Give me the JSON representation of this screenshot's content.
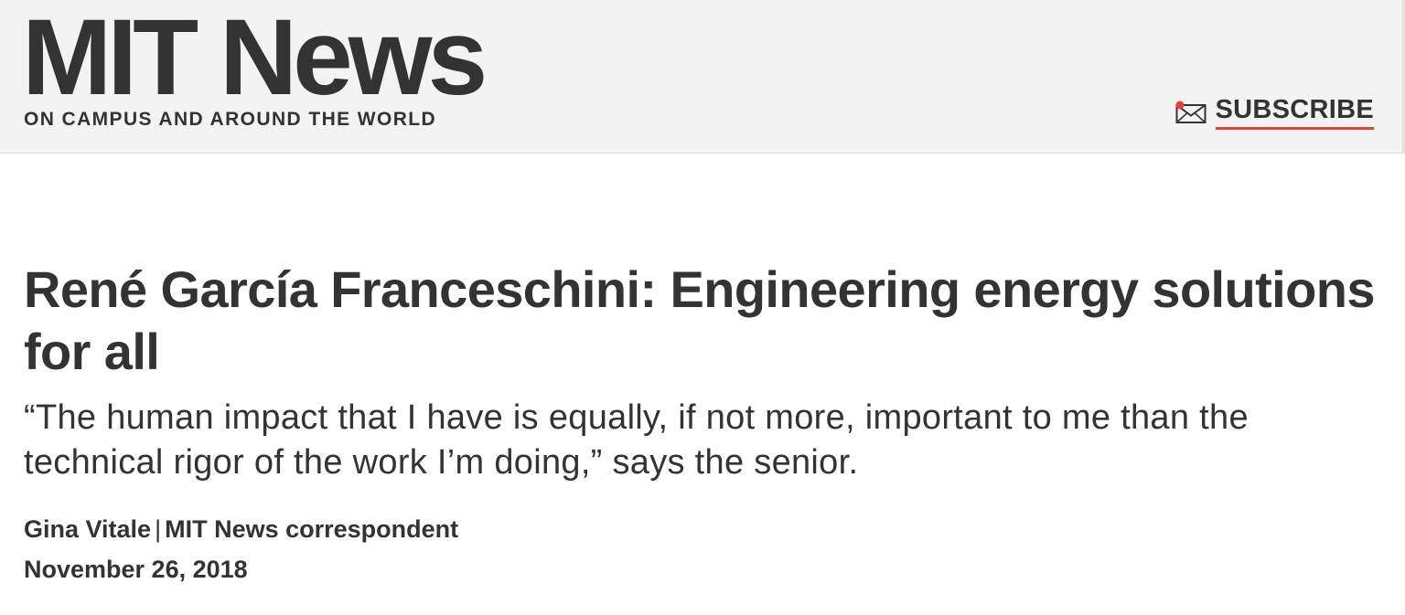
{
  "header": {
    "logo_text": "MIT News",
    "tagline": "ON CAMPUS AND AROUND THE WORLD",
    "subscribe_label": "SUBSCRIBE",
    "subscribe_icon": "mail-icon"
  },
  "article": {
    "headline": "René García Franceschini: Engineering energy solutions for all",
    "dek": "“The human impact that I have is equally, if not more, important to me than the technical rigor of the work I’m doing,” says the senior.",
    "author": "Gina Vitale",
    "separator": "|",
    "author_role": "MIT News correspondent",
    "date": "November 26, 2018"
  },
  "colors": {
    "header_bg": "#f3f3f3",
    "text": "#333333",
    "accent": "#e4423b"
  }
}
